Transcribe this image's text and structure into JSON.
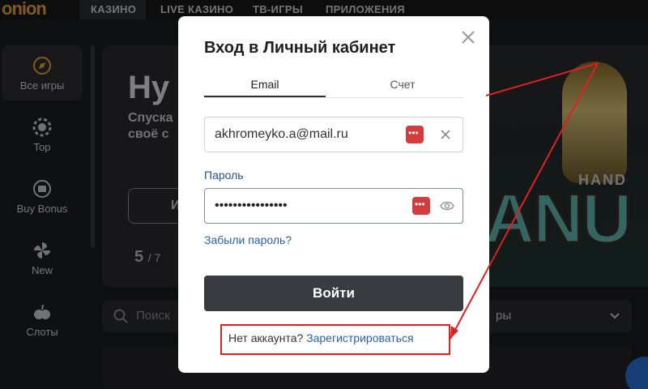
{
  "topnav": {
    "logo": "onion",
    "items": [
      "КАЗИНО",
      "LIVE КАЗИНО",
      "ТВ-ИГРЫ",
      "ПРИЛОЖЕНИЯ"
    ]
  },
  "sidebar": {
    "items": [
      {
        "label": "Все игры",
        "icon": "compass-icon"
      },
      {
        "label": "Top",
        "icon": "poker-chip-icon"
      },
      {
        "label": "Buy Bonus",
        "icon": "bonus-coin-icon"
      },
      {
        "label": "New",
        "icon": "pinwheel-icon"
      },
      {
        "label": "Слоты",
        "icon": "fruit-icon"
      }
    ]
  },
  "hero": {
    "title": "Ну",
    "subtitle": "Спуска своё с",
    "pager_current": "5",
    "pager_total": "/ 7",
    "button_label": "И"
  },
  "game_art": {
    "hand_text": "HAND",
    "anu_text": "ANU"
  },
  "search": {
    "placeholder": "Поиск",
    "right_text": "ры"
  },
  "modal": {
    "title": "Вход в Личный кабинет",
    "tabs": [
      "Email",
      "Счет"
    ],
    "email_value": "akhromeyko.a@mail.ru",
    "password_label": "Пароль",
    "password_value": "••••••••••••••••",
    "forgot_link": "Забыли пароль?",
    "login_button": "Войти",
    "register_prompt": "Нет аккаунта?",
    "register_link": "Зарегистрироваться"
  },
  "colors": {
    "accent_logo": "#e6a43a",
    "link_blue": "#2a5fa8",
    "highlight_red": "#e02020",
    "login_button_bg": "#3a3b40"
  }
}
